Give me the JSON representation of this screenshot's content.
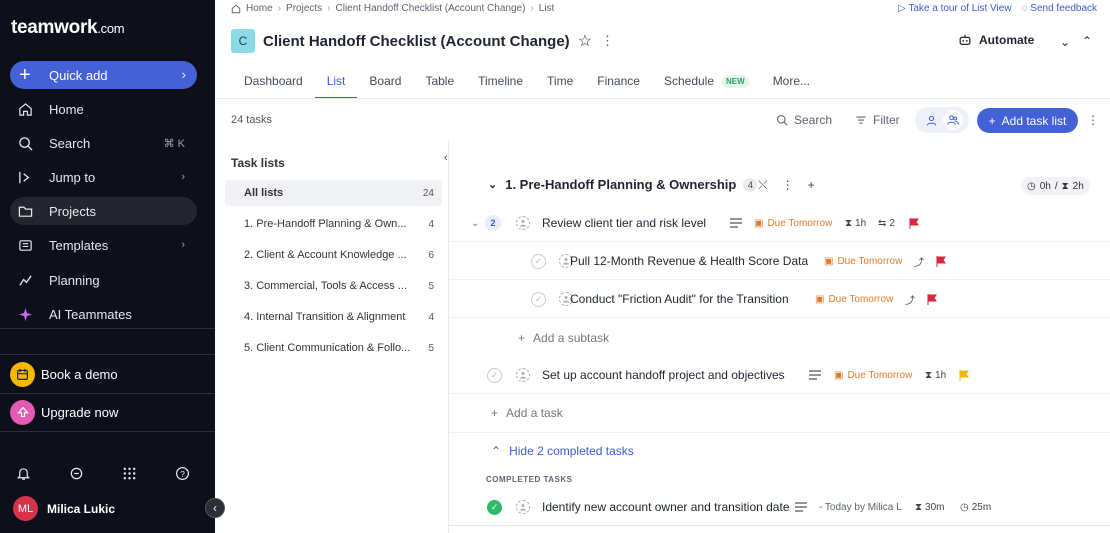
{
  "sidebar": {
    "logo": "teamwork",
    "logo_suffix": ".com",
    "quick_add": "Quick add",
    "items": [
      {
        "label": "Home",
        "trail": ""
      },
      {
        "label": "Search",
        "trail": "⌘ K"
      },
      {
        "label": "Jump to",
        "trail": "›"
      },
      {
        "label": "Projects",
        "trail": ""
      },
      {
        "label": "Templates",
        "trail": "›"
      },
      {
        "label": "Planning",
        "trail": ""
      },
      {
        "label": "AI Teammates",
        "trail": ""
      }
    ],
    "book_demo": "Book a demo",
    "upgrade": "Upgrade now",
    "user_initials": "ML",
    "user_name": "Milica Lukic"
  },
  "breadcrumb": [
    "Home",
    "Projects",
    "Client Handoff Checklist (Account Change)",
    "List"
  ],
  "top_links": {
    "tour": "Take a tour of List View",
    "feedback": "Send feedback"
  },
  "project": {
    "icon_letter": "C",
    "title": "Client Handoff Checklist (Account Change)",
    "automate": "Automate"
  },
  "tabs": [
    "Dashboard",
    "List",
    "Board",
    "Table",
    "Timeline",
    "Time",
    "Finance",
    "Schedule",
    "More..."
  ],
  "tab_new_badge": "NEW",
  "toolbar": {
    "count": "24 tasks",
    "search": "Search",
    "filter": "Filter",
    "add_list": "Add task list"
  },
  "task_lists": {
    "title": "Task lists",
    "items": [
      {
        "label": "All lists",
        "count": "24"
      },
      {
        "label": "1. Pre-Handoff Planning & Own...",
        "count": "4"
      },
      {
        "label": "2. Client & Account Knowledge ...",
        "count": "6"
      },
      {
        "label": "3. Commercial, Tools & Access ...",
        "count": "5"
      },
      {
        "label": "4. Internal Transition & Alignment",
        "count": "4"
      },
      {
        "label": "5. Client Communication & Follo...",
        "count": "5"
      }
    ]
  },
  "section": {
    "title": "1. Pre-Handoff Planning & Ownership",
    "count": "4",
    "time_logged": "0h",
    "time_est": "2h"
  },
  "tasks": [
    {
      "name": "Review client tier and risk level",
      "subtasks": "2",
      "due": "Due Tomorrow",
      "est": "1h",
      "sub_count": "2",
      "flag": "#d9263b"
    },
    {
      "name": "Pull 12-Month Revenue & Health Score Data",
      "due": "Due Tomorrow",
      "flag": "#d9263b"
    },
    {
      "name": "Conduct \"Friction Audit\" for the Transition",
      "due": "Due Tomorrow",
      "flag": "#d9263b"
    },
    {
      "name": "Set up account handoff project and objectives",
      "due": "Due Tomorrow",
      "est": "1h",
      "flag": "#f5b800"
    }
  ],
  "add_subtask": "Add a subtask",
  "add_task": "Add a task",
  "hide_completed": "Hide 2 completed tasks",
  "completed_label": "COMPLETED TASKS",
  "completed_task": {
    "name": "Identify new account owner and transition date",
    "completed_by": "- Today by Milica L",
    "est": "30m",
    "logged": "25m"
  }
}
